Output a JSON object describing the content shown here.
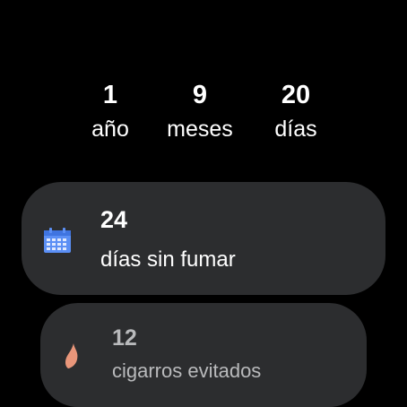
{
  "counters": [
    {
      "value": "1",
      "unit": "año"
    },
    {
      "value": "9",
      "unit": "meses"
    },
    {
      "value": "20",
      "unit": "días"
    }
  ],
  "cards": [
    {
      "value": "24",
      "label": "días sin fumar",
      "icon": "calendar-icon"
    },
    {
      "value": "12",
      "label": "cigarros evitados",
      "icon": "flame-icon"
    }
  ],
  "colors": {
    "background": "#000000",
    "card": "#2c2d2f",
    "calendar_icon": "#5b8ff5",
    "flame_icon": "#e9967a",
    "muted_text": "#b9babc"
  }
}
